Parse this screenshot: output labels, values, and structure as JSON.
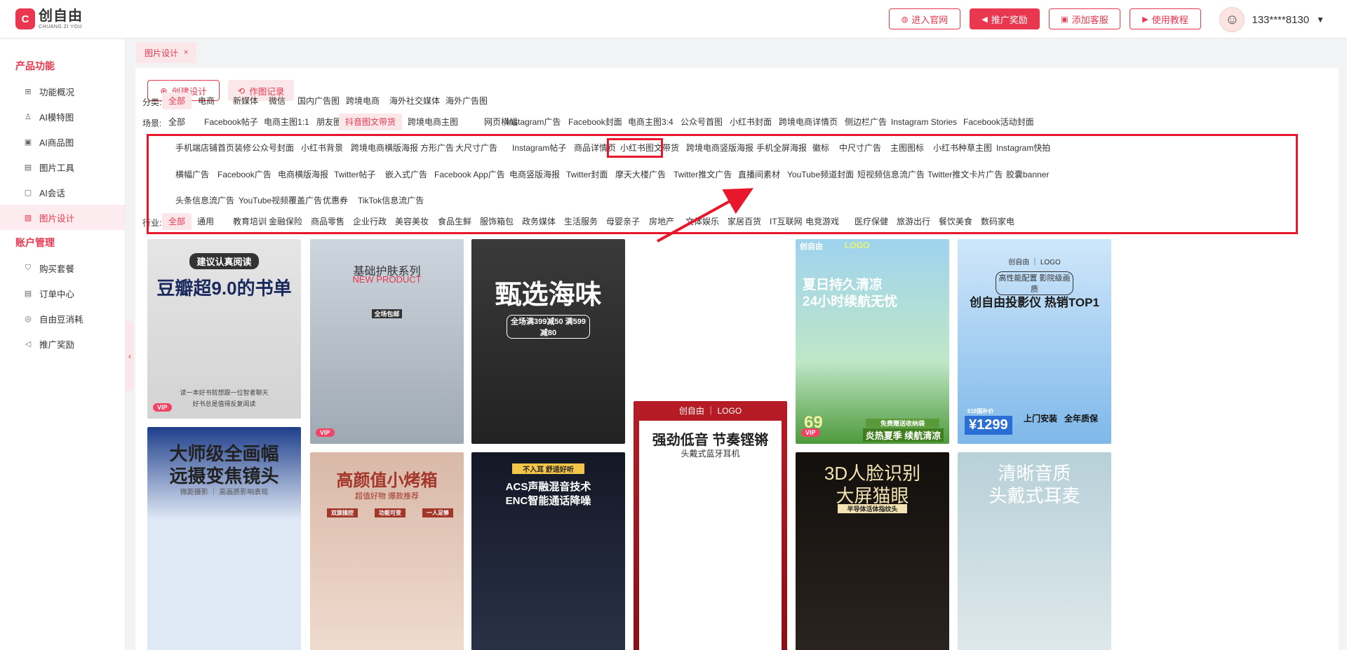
{
  "logo": {
    "mark": "C",
    "name_cn": "创自由",
    "name_en": "CHUANG ZI YOU"
  },
  "header": {
    "buttons": [
      {
        "label": "进入官网",
        "icon": "globe-icon"
      },
      {
        "label": "推广奖励",
        "icon": "megaphone-icon"
      },
      {
        "label": "添加客服",
        "icon": "gift-icon"
      },
      {
        "label": "使用教程",
        "icon": "play-icon"
      }
    ],
    "user": "133****8130"
  },
  "sidebar": {
    "section1": "产品功能",
    "items1": [
      "功能概况",
      "AI模特图",
      "AI商品图",
      "图片工具",
      "AI会话",
      "图片设计"
    ],
    "section2": "账户管理",
    "items2": [
      "购买套餐",
      "订单中心",
      "自由豆消耗",
      "推广奖励"
    ]
  },
  "tab": {
    "label": "图片设计"
  },
  "actions": {
    "create": "创建设计",
    "history": "作图记录"
  },
  "filters": {
    "category_label": "分类:",
    "categories": [
      "全部",
      "电商",
      "新媒体",
      "微信",
      "国内广告图",
      "跨境电商",
      "海外社交媒体",
      "海外广告图"
    ],
    "scene_label": "场景:",
    "scenes_row1": [
      "全部",
      "Facebook帖子",
      "电商主图1:1",
      "朋友圈",
      "抖音图文带货",
      "跨境电商主图",
      "网页横幅",
      "Instagram广告",
      "Facebook封面",
      "电商主图3:4",
      "公众号首图",
      "小红书封面",
      "跨境电商详情页",
      "侧边栏广告",
      "Instagram Stories",
      "Facebook活动封面"
    ],
    "scenes_row2": [
      "手机端店铺首页装修",
      "公众号封面",
      "小红书背景",
      "跨境电商横版海报",
      "方形广告",
      "大尺寸广告",
      "Instagram帖子",
      "商品详情页",
      "小红书图文带货",
      "跨境电商竖版海报",
      "手机全屏海报",
      "徽标",
      "中尺寸广告",
      "主图图标",
      "小红书种草主图",
      "Instagram快拍"
    ],
    "scenes_row3": [
      "横幅广告",
      "Facebook广告",
      "电商横版海报",
      "Twitter帖子",
      "嵌入式广告",
      "Facebook App广告",
      "电商竖版海报",
      "Twitter封面",
      "摩天大楼广告",
      "Twitter推文广告",
      "直播间素材",
      "YouTube频道封面",
      "短视频信息流广告",
      "Twitter推文卡片广告",
      "胶囊banner"
    ],
    "scenes_row4": [
      "头条信息流广告",
      "YouTube视频覆盖广告",
      "优惠券",
      "TikTok信息流广告"
    ],
    "industry_label": "行业:",
    "industries": [
      "全部",
      "通用",
      "教育培训",
      "金融保险",
      "商品零售",
      "企业行政",
      "美容美妆",
      "食品生鲜",
      "服饰箱包",
      "政务媒体",
      "生活服务",
      "母婴亲子",
      "房地产",
      "文体娱乐",
      "家居百货",
      "IT互联网",
      "电竞游戏",
      "医疗保健",
      "旅游出行",
      "餐饮美食",
      "数码家电"
    ]
  },
  "cards": [
    {
      "t1": "建议认真阅读",
      "t2": "豆瓣超9.0的书单",
      "t3": "读一本好书就想跟一位智者聊天",
      "t4": "好书总是值得反复阅读",
      "vip": "VIP"
    },
    {
      "t1": "基础护肤系列",
      "t2": "NEW PRODUCT",
      "t3": "全场包邮",
      "vip": "VIP"
    },
    {
      "t1": "甄选海味",
      "t2": "全场满399减50 满599减80"
    },
    {
      "t1": "创自由 ｜ LOGO",
      "t2": "强劲低音 节奏铿锵",
      "t3": "头戴式蓝牙耳机"
    },
    {
      "t0": "创自由",
      "tl": "LOGO",
      "t1": "夏日持久清凉",
      "t2": "24小时续航无忧",
      "t3": "免费赠送收纳袋",
      "t4": "炎热夏季 续航清凉",
      "price": "69",
      "vip": "VIP"
    },
    {
      "t0": "创自由 ｜ LOGO",
      "t1": "高性能配置 影院级画质",
      "t2": "创自由投影仪 热销TOP1",
      "t3": "上门安装",
      "t4": "全年质保",
      "price": "¥1299",
      "badge": "618国补价"
    },
    {
      "t1": "大师级全画幅",
      "t2": "远摄变焦镜头",
      "t3": "微距摄影 ｜ 高画质影响表现"
    },
    {
      "t1": "高颜值小烤箱",
      "t2": "超值好物 爆款推荐",
      "t3": "双旋操控",
      "t4": "功能可变",
      "t5": "一人足够"
    },
    {
      "t1": "不入耳 舒适好听",
      "t2": "ACS声融混音技术",
      "t3": "ENC智能通话降噪"
    },
    {
      "t1": "3D人脸识别",
      "t2": "大屏猫眼",
      "t3": "半导体活体指纹头"
    },
    {
      "t1": "清晰音质",
      "t2": "头戴式耳麦"
    }
  ]
}
